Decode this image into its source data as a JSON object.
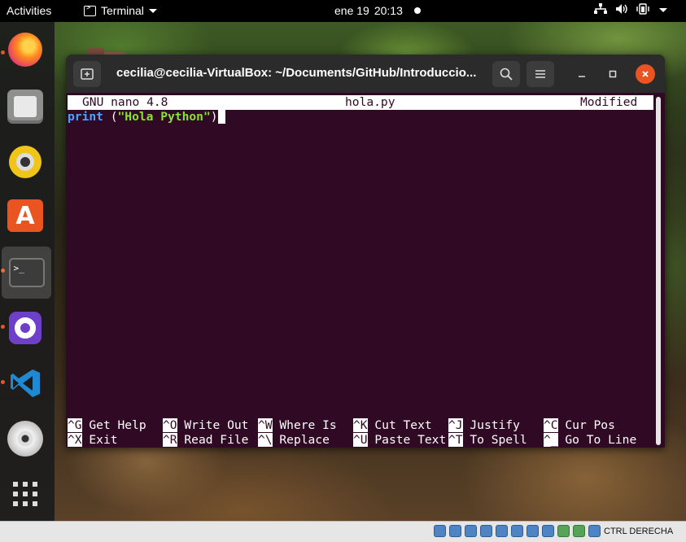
{
  "topbar": {
    "activities": "Activities",
    "app_name": "Terminal",
    "date": "ene 19",
    "time": "20:13"
  },
  "dock": {
    "items": [
      {
        "name": "Firefox",
        "icon": "firefox-icon"
      },
      {
        "name": "Files",
        "icon": "files-icon"
      },
      {
        "name": "Rhythmbox",
        "icon": "rhythmbox-icon"
      },
      {
        "name": "Ubuntu Software",
        "icon": "software-store-icon"
      },
      {
        "name": "Terminal",
        "icon": "terminal-icon",
        "active": true,
        "terminal_glyph": ">_"
      },
      {
        "name": "GitHub Desktop",
        "icon": "github-icon"
      },
      {
        "name": "Visual Studio Code",
        "icon": "vscode-icon"
      },
      {
        "name": "DVD",
        "icon": "dvd-icon"
      },
      {
        "name": "Show Applications",
        "icon": "app-grid-icon"
      }
    ]
  },
  "window": {
    "title": "cecilia@cecilia-VirtualBox: ~/Documents/GitHub/Introduccio..."
  },
  "nano": {
    "version": "GNU nano 4.8",
    "filename": "hola.py",
    "status": "Modified",
    "code": {
      "keyword": "print",
      "open": " (",
      "string": "\"Hola Python\"",
      "close": ")"
    },
    "shortcuts_row1": [
      {
        "key": "^G",
        "label": "Get Help"
      },
      {
        "key": "^O",
        "label": "Write Out"
      },
      {
        "key": "^W",
        "label": "Where Is"
      },
      {
        "key": "^K",
        "label": "Cut Text"
      },
      {
        "key": "^J",
        "label": "Justify"
      },
      {
        "key": "^C",
        "label": "Cur Pos"
      }
    ],
    "shortcuts_row2": [
      {
        "key": "^X",
        "label": "Exit"
      },
      {
        "key": "^R",
        "label": "Read File"
      },
      {
        "key": "^\\",
        "label": "Replace"
      },
      {
        "key": "^U",
        "label": "Paste Text"
      },
      {
        "key": "^T",
        "label": "To Spell"
      },
      {
        "key": "^_",
        "label": "Go To Line"
      }
    ]
  },
  "statusbar": {
    "host_key": "CTRL DERECHA"
  },
  "colors": {
    "terminal_bg": "#300a24",
    "accent": "#e95420",
    "keyword": "#4aa3ff",
    "string": "#8ae234"
  }
}
